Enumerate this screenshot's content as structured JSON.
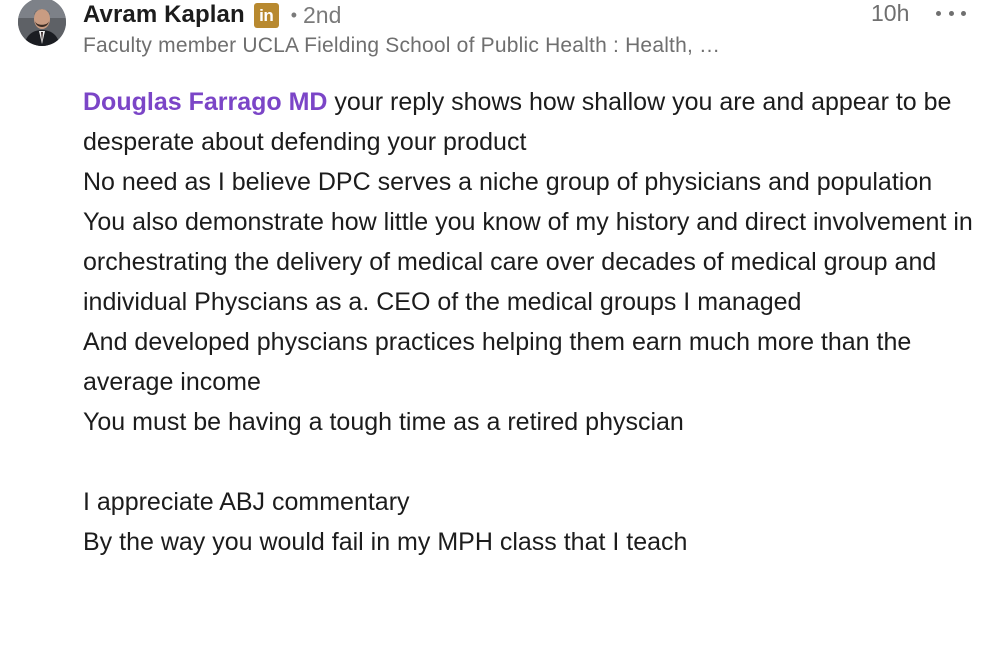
{
  "comment": {
    "author": {
      "name": "Avram Kaplan",
      "badge": "in",
      "degree": "2nd",
      "headline": "Faculty member UCLA Fielding School of Public Health : Health, …"
    },
    "timestamp": "10h",
    "menu_icon": "more-horizontal-icon",
    "mention": "Douglas Farrago MD",
    "paragraph_1": " your reply shows how shallow you are and appear to be desperate about defending your product",
    "paragraph_2": "No need as I believe DPC serves a niche group of physicians and population",
    "paragraph_3": "You also demonstrate how little you know of my history and direct involvement in orchestrating the delivery of medical care over decades of medical group and individual Physcians as a. CEO of the medical groups I managed",
    "paragraph_4": "And developed physcians practices helping them earn much more than the average income",
    "paragraph_5": "You must be having a tough time as a retired physcian",
    "paragraph_6": "I appreciate ABJ commentary",
    "paragraph_7": "By the way you would fail in my MPH class that I teach"
  },
  "colors": {
    "mention": "#7b45c7",
    "badge": "#b8892f",
    "secondary_text": "#6f6f6f"
  }
}
